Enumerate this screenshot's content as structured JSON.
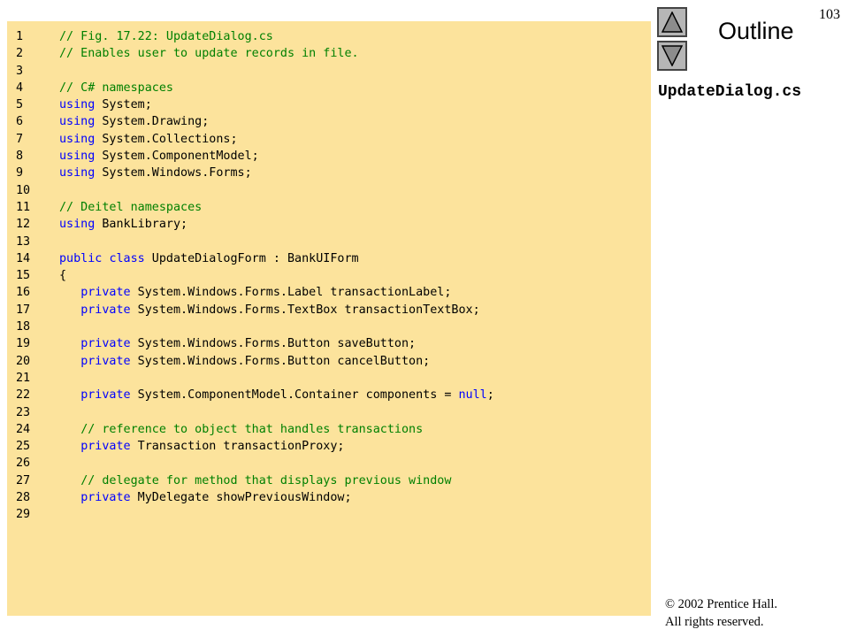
{
  "page_number": "103",
  "nav": {
    "up_label": "Previous slide",
    "down_label": "Next slide"
  },
  "outline_label": "Outline",
  "file_name": "UpdateDialog.cs",
  "copyright": {
    "line1": "© 2002 Prentice Hall.",
    "line2": "All rights reserved."
  },
  "colors": {
    "panel": "#fce39c",
    "comment": "#008000",
    "keyword": "#0000ff",
    "button": "#b6b6b6"
  },
  "code_lines": [
    {
      "n": "1",
      "parts": [
        {
          "t": "// Fig. 17.22: UpdateDialog.cs",
          "c": "comment"
        }
      ]
    },
    {
      "n": "2",
      "parts": [
        {
          "t": "// Enables user to update records in file.",
          "c": "comment"
        }
      ]
    },
    {
      "n": "3",
      "parts": []
    },
    {
      "n": "4",
      "parts": [
        {
          "t": "// C# namespaces",
          "c": "comment"
        }
      ]
    },
    {
      "n": "5",
      "parts": [
        {
          "t": "using",
          "c": "keyword"
        },
        {
          "t": " System;",
          "c": "plain"
        }
      ]
    },
    {
      "n": "6",
      "parts": [
        {
          "t": "using",
          "c": "keyword"
        },
        {
          "t": " System.Drawing;",
          "c": "plain"
        }
      ]
    },
    {
      "n": "7",
      "parts": [
        {
          "t": "using",
          "c": "keyword"
        },
        {
          "t": " System.Collections;",
          "c": "plain"
        }
      ]
    },
    {
      "n": "8",
      "parts": [
        {
          "t": "using",
          "c": "keyword"
        },
        {
          "t": " System.ComponentModel;",
          "c": "plain"
        }
      ]
    },
    {
      "n": "9",
      "parts": [
        {
          "t": "using",
          "c": "keyword"
        },
        {
          "t": " System.Windows.Forms;",
          "c": "plain"
        }
      ]
    },
    {
      "n": "10",
      "parts": []
    },
    {
      "n": "11",
      "parts": [
        {
          "t": "// Deitel namespaces",
          "c": "comment"
        }
      ]
    },
    {
      "n": "12",
      "parts": [
        {
          "t": "using",
          "c": "keyword"
        },
        {
          "t": " BankLibrary;",
          "c": "plain"
        }
      ]
    },
    {
      "n": "13",
      "parts": []
    },
    {
      "n": "14",
      "parts": [
        {
          "t": "public",
          "c": "keyword"
        },
        {
          "t": " ",
          "c": "plain"
        },
        {
          "t": "class",
          "c": "keyword"
        },
        {
          "t": " UpdateDialogForm : BankUIForm",
          "c": "plain"
        }
      ]
    },
    {
      "n": "15",
      "parts": [
        {
          "t": "{",
          "c": "plain"
        }
      ]
    },
    {
      "n": "16",
      "parts": [
        {
          "t": "   ",
          "c": "plain"
        },
        {
          "t": "private",
          "c": "keyword"
        },
        {
          "t": " System.Windows.Forms.Label transactionLabel;",
          "c": "plain"
        }
      ]
    },
    {
      "n": "17",
      "parts": [
        {
          "t": "   ",
          "c": "plain"
        },
        {
          "t": "private",
          "c": "keyword"
        },
        {
          "t": " System.Windows.Forms.TextBox transactionTextBox;",
          "c": "plain"
        }
      ]
    },
    {
      "n": "18",
      "parts": []
    },
    {
      "n": "19",
      "parts": [
        {
          "t": "   ",
          "c": "plain"
        },
        {
          "t": "private",
          "c": "keyword"
        },
        {
          "t": " System.Windows.Forms.Button saveButton;",
          "c": "plain"
        }
      ]
    },
    {
      "n": "20",
      "parts": [
        {
          "t": "   ",
          "c": "plain"
        },
        {
          "t": "private",
          "c": "keyword"
        },
        {
          "t": " System.Windows.Forms.Button cancelButton;",
          "c": "plain"
        }
      ]
    },
    {
      "n": "21",
      "parts": []
    },
    {
      "n": "22",
      "parts": [
        {
          "t": "   ",
          "c": "plain"
        },
        {
          "t": "private",
          "c": "keyword"
        },
        {
          "t": " System.ComponentModel.Container components = ",
          "c": "plain"
        },
        {
          "t": "null",
          "c": "keyword"
        },
        {
          "t": ";",
          "c": "plain"
        }
      ]
    },
    {
      "n": "23",
      "parts": []
    },
    {
      "n": "24",
      "parts": [
        {
          "t": "   ",
          "c": "plain"
        },
        {
          "t": "// reference to object that handles transactions",
          "c": "comment"
        }
      ]
    },
    {
      "n": "25",
      "parts": [
        {
          "t": "   ",
          "c": "plain"
        },
        {
          "t": "private",
          "c": "keyword"
        },
        {
          "t": " Transaction transactionProxy;",
          "c": "plain"
        }
      ]
    },
    {
      "n": "26",
      "parts": []
    },
    {
      "n": "27",
      "parts": [
        {
          "t": "   ",
          "c": "plain"
        },
        {
          "t": "// delegate for method that displays previous window",
          "c": "comment"
        }
      ]
    },
    {
      "n": "28",
      "parts": [
        {
          "t": "   ",
          "c": "plain"
        },
        {
          "t": "private",
          "c": "keyword"
        },
        {
          "t": " MyDelegate showPreviousWindow;",
          "c": "plain"
        }
      ]
    },
    {
      "n": "29",
      "parts": []
    }
  ]
}
